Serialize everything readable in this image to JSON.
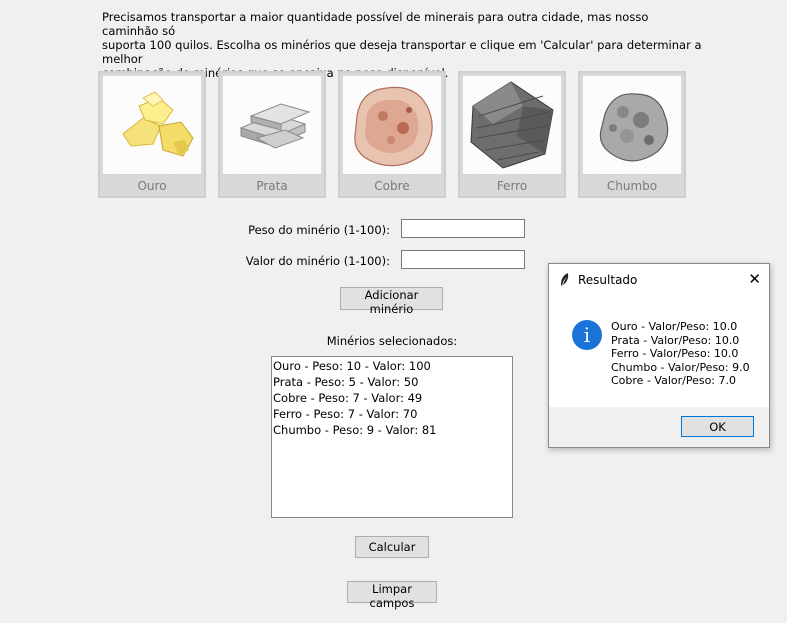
{
  "intro_lines": [
    "Precisamos transportar a maior quantidade possível de minerais para outra cidade, mas nosso caminhão só",
    "suporta 100 quilos. Escolha os minérios que deseja transportar e clique em 'Calcular' para determinar a melhor",
    "combinação de minérios que se encaixa no peso disponível."
  ],
  "minerals": [
    {
      "name": "Ouro",
      "icon": "gold-nuggets-icon"
    },
    {
      "name": "Prata",
      "icon": "silver-bars-icon"
    },
    {
      "name": "Cobre",
      "icon": "copper-ore-icon"
    },
    {
      "name": "Ferro",
      "icon": "iron-ore-icon"
    },
    {
      "name": "Chumbo",
      "icon": "lead-ore-icon"
    }
  ],
  "form": {
    "weight_label": "Peso do minério (1-100):",
    "weight_value": "",
    "value_label": "Valor do minério (1-100):",
    "value_value": "",
    "add_button": "Adicionar minério"
  },
  "selected": {
    "title": "Minérios selecionados:",
    "items": [
      "Ouro - Peso: 10 - Valor: 100",
      "Prata - Peso: 5 - Valor: 50",
      "Cobre - Peso: 7 - Valor: 49",
      "Ferro - Peso: 7 - Valor: 70",
      "Chumbo - Peso: 9 - Valor: 81"
    ]
  },
  "buttons": {
    "calculate": "Calcular",
    "clear": "Limpar campos"
  },
  "dialog": {
    "title": "Resultado",
    "close": "✕",
    "lines": [
      "Ouro - Valor/Peso: 10.0",
      "Prata - Valor/Peso: 10.0",
      "Ferro - Valor/Peso: 10.0",
      "Chumbo - Valor/Peso: 9.0",
      "Cobre - Valor/Peso: 7.0"
    ],
    "ok": "OK",
    "info_glyph": "i",
    "info_color": "#1a73d9"
  }
}
